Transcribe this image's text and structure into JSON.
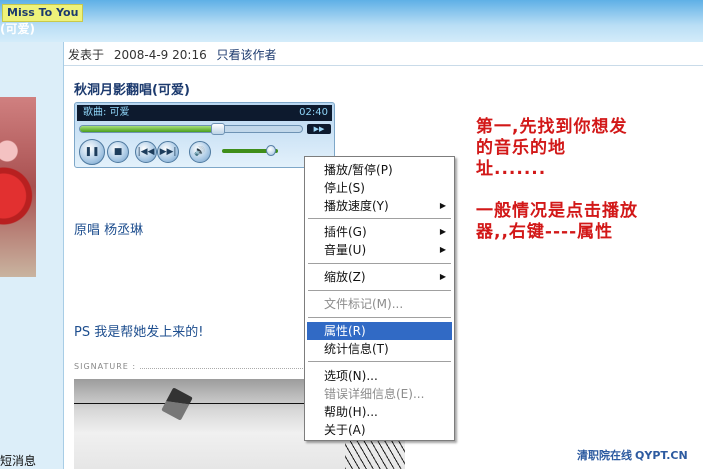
{
  "header": {
    "logo": "Miss To You",
    "thread_title": "(可爱)"
  },
  "sidebar": {
    "message_link": "短消息"
  },
  "post": {
    "posted_label": "发表于",
    "date": "2008-4-9 20:16",
    "author_only": "只看该作者",
    "title": "秋洞月影翻唱(可爱)",
    "original_singer": "原唱 杨丞琳",
    "ps": "PS 我是帮她发上来的!",
    "signature_label": "SIGNATURE :"
  },
  "player": {
    "song_label": "歌曲: 可爱",
    "time": "02:40",
    "progress": 0.62,
    "volume": 0.88,
    "buttons": {
      "pause": "❚❚",
      "stop": "■",
      "prev": "|◀◀",
      "next": "▶▶|",
      "mute": "🔊",
      "expand": "▶▶"
    },
    "icons": [
      "pause-icon",
      "stop-icon",
      "previous-icon",
      "next-icon",
      "speaker-icon",
      "expand-icon"
    ]
  },
  "annotation": {
    "lines": [
      "第一,先找到你想发",
      "的音乐的地",
      "址.......",
      "",
      "一般情况是点击播放",
      "器,,右键----属性"
    ]
  },
  "context_menu": {
    "items": [
      {
        "label": "播放/暂停(P)",
        "disabled": false,
        "submenu": false
      },
      {
        "label": "停止(S)",
        "disabled": false,
        "submenu": false
      },
      {
        "label": "播放速度(Y)",
        "disabled": false,
        "submenu": true
      },
      {
        "label": "插件(G)",
        "disabled": false,
        "submenu": true
      },
      {
        "label": "音量(U)",
        "disabled": false,
        "submenu": true
      },
      {
        "label": "缩放(Z)",
        "disabled": false,
        "submenu": true
      },
      {
        "label": "文件标记(M)...",
        "disabled": true,
        "submenu": false
      },
      {
        "label": "属性(R)",
        "disabled": false,
        "submenu": false,
        "selected": true
      },
      {
        "label": "统计信息(T)",
        "disabled": false,
        "submenu": false
      },
      {
        "label": "选项(N)...",
        "disabled": false,
        "submenu": false
      },
      {
        "label": "错误详细信息(E)...",
        "disabled": true,
        "submenu": false
      },
      {
        "label": "帮助(H)...",
        "disabled": false,
        "submenu": false
      },
      {
        "label": "关于(A)",
        "disabled": false,
        "submenu": false
      }
    ],
    "submenu_arrow": "▶",
    "selected_color": "#316ac5"
  },
  "watermark": {
    "name": "清职院在线",
    "code": "QYPT.CN"
  },
  "colors": {
    "annotation": "#d21818",
    "link": "#1f4f8f",
    "header": "#5fb0e6"
  }
}
